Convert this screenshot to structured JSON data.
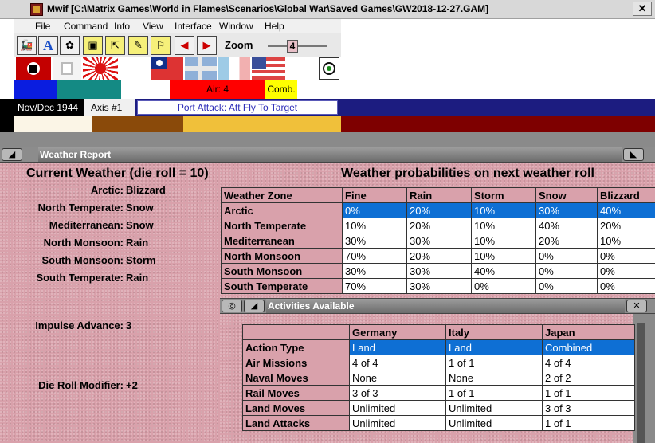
{
  "window": {
    "title": "Mwif [C:\\Matrix Games\\World in Flames\\Scenarios\\Global War\\Saved Games\\GW2018-12-27.GAM]",
    "close_glyph": "✕"
  },
  "menu": [
    "File",
    "Command",
    "Info",
    "View",
    "Interface",
    "Window",
    "Help"
  ],
  "toolbar": {
    "zoom_label": "Zoom",
    "zoom_value": "4",
    "buttons": [
      "train-icon",
      "text-icon",
      "gear-icon",
      "select-icon",
      "cursor-icon",
      "wand-icon",
      "flag-icon",
      "arrow-left-icon",
      "arrow-right-icon"
    ],
    "btn_text": "A"
  },
  "status": {
    "air_text": "Air: 4",
    "comb_text": "Comb.",
    "date": "Nov/Dec 1944",
    "axis": "Axis #1",
    "phase": "Port Attack: Att Fly To Target"
  },
  "colors": {
    "status_blue": "#1c1c80",
    "air_red": "#ff0000",
    "comb_yellow": "#ffff00",
    "panel_pink": "#d9a1ab",
    "selected_blue": "#0e6fd4"
  },
  "weather_report": {
    "panel_title": "Weather Report",
    "current_header": "Current Weather (die roll = 10)",
    "prob_header": "Weather probabilities on next weather roll",
    "current": [
      {
        "zone": "Arctic:",
        "weather": "Blizzard"
      },
      {
        "zone": "North Temperate:",
        "weather": "Snow"
      },
      {
        "zone": "Mediterranean:",
        "weather": "Snow"
      },
      {
        "zone": "North Monsoon:",
        "weather": "Rain"
      },
      {
        "zone": "South Monsoon:",
        "weather": "Storm"
      },
      {
        "zone": "South Temperate:",
        "weather": "Rain"
      }
    ],
    "impulse_label": "Impulse Advance:",
    "impulse_value": "3",
    "die_label": "Die Roll Modifier:",
    "die_value": "+2",
    "prob_columns": [
      "Weather Zone",
      "Fine",
      "Rain",
      "Storm",
      "Snow",
      "Blizzard"
    ],
    "prob_rows": [
      [
        "Arctic",
        "0%",
        "20%",
        "10%",
        "30%",
        "40%"
      ],
      [
        "North Temperate",
        "10%",
        "20%",
        "10%",
        "40%",
        "20%"
      ],
      [
        "Mediterranean",
        "30%",
        "30%",
        "10%",
        "20%",
        "10%"
      ],
      [
        "North Monsoon",
        "70%",
        "20%",
        "10%",
        "0%",
        "0%"
      ],
      [
        "South Monsoon",
        "30%",
        "30%",
        "40%",
        "0%",
        "0%"
      ],
      [
        "South Temperate",
        "70%",
        "30%",
        "0%",
        "0%",
        "0%"
      ]
    ]
  },
  "activities": {
    "panel_title": "Activities Available",
    "columns": [
      "",
      "Germany",
      "Italy",
      "Japan"
    ],
    "rows": [
      [
        "Action Type",
        "Land",
        "Land",
        "Combined"
      ],
      [
        "Air Missions",
        "4 of 4",
        "1 of 1",
        "4 of 4"
      ],
      [
        "Naval Moves",
        "None",
        "None",
        "2 of 2"
      ],
      [
        "Rail Moves",
        "3 of 3",
        "1 of 1",
        "1 of 1"
      ],
      [
        "Land Moves",
        "Unlimited",
        "Unlimited",
        "3 of 3"
      ],
      [
        "Land Attacks",
        "Unlimited",
        "Unlimited",
        "1 of 1"
      ]
    ]
  }
}
